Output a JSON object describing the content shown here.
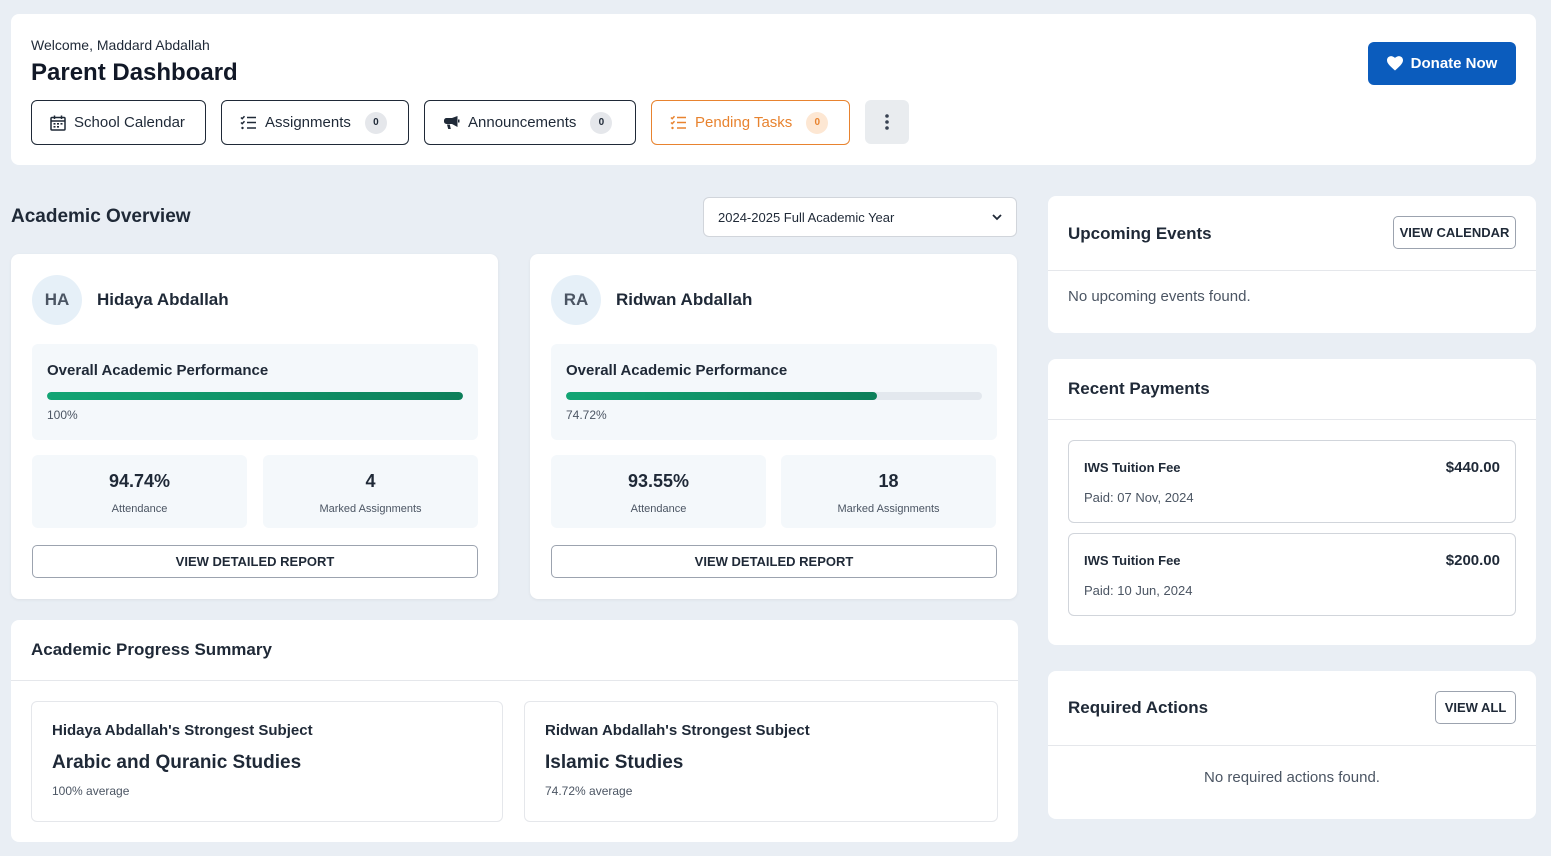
{
  "header": {
    "welcome": "Welcome, Maddard Abdallah",
    "title": "Parent Dashboard",
    "donate_label": "Donate Now",
    "nav": [
      {
        "label": "School Calendar",
        "icon": "calendar-icon"
      },
      {
        "label": "Assignments",
        "icon": "checklist-icon",
        "badge": "0"
      },
      {
        "label": "Announcements",
        "icon": "megaphone-icon",
        "badge": "0"
      },
      {
        "label": "Pending Tasks",
        "icon": "checklist-icon",
        "badge": "0"
      }
    ]
  },
  "overview": {
    "title": "Academic Overview",
    "year_selected": "2024-2025 Full Academic Year",
    "students": [
      {
        "initials": "HA",
        "name": "Hidaya Abdallah",
        "perf_label": "Overall Academic Performance",
        "perf_value": "100%",
        "perf_fraction": 1.0,
        "attendance_value": "94.74%",
        "attendance_label": "Attendance",
        "assignments_value": "4",
        "assignments_label": "Marked Assignments",
        "report_label": "VIEW DETAILED REPORT"
      },
      {
        "initials": "RA",
        "name": "Ridwan Abdallah",
        "perf_label": "Overall Academic Performance",
        "perf_value": "74.72%",
        "perf_fraction": 0.7472,
        "attendance_value": "93.55%",
        "attendance_label": "Attendance",
        "assignments_value": "18",
        "assignments_label": "Marked Assignments",
        "report_label": "VIEW DETAILED REPORT"
      }
    ]
  },
  "progress": {
    "title": "Academic Progress Summary",
    "subjects": [
      {
        "who": "Hidaya Abdallah's Strongest Subject",
        "subject": "Arabic and Quranic Studies",
        "avg": "100% average"
      },
      {
        "who": "Ridwan Abdallah's Strongest Subject",
        "subject": "Islamic Studies",
        "avg": "74.72% average"
      }
    ]
  },
  "events": {
    "title": "Upcoming Events",
    "button": "VIEW CALENDAR",
    "empty": "No upcoming events found."
  },
  "payments": {
    "title": "Recent Payments",
    "items": [
      {
        "name": "IWS Tuition Fee",
        "amount": "$440.00",
        "date": "Paid: 07 Nov, 2024"
      },
      {
        "name": "IWS Tuition Fee",
        "amount": "$200.00",
        "date": "Paid: 10 Jun, 2024"
      }
    ]
  },
  "actions": {
    "title": "Required Actions",
    "button": "VIEW ALL",
    "empty": "No required actions found."
  },
  "colors": {
    "primary": "#0b5cbd",
    "warning": "#e8832f",
    "success": "#12a574"
  }
}
